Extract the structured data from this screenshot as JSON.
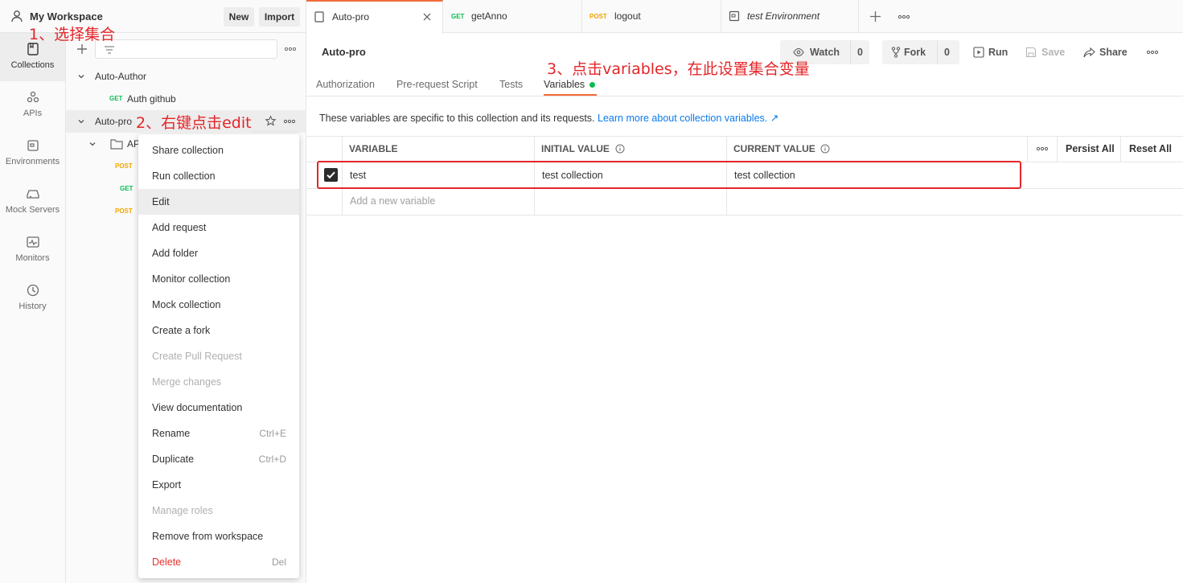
{
  "workspace": {
    "title": "My Workspace",
    "new_label": "New",
    "import_label": "Import"
  },
  "rail": {
    "items": [
      {
        "label": "Collections",
        "icon": "collections-icon"
      },
      {
        "label": "APIs",
        "icon": "apis-icon"
      },
      {
        "label": "Environments",
        "icon": "environments-icon"
      },
      {
        "label": "Mock Servers",
        "icon": "mock-servers-icon"
      },
      {
        "label": "Monitors",
        "icon": "monitors-icon"
      },
      {
        "label": "History",
        "icon": "history-icon"
      }
    ]
  },
  "sidebar": {
    "tree": {
      "auto_author": "Auto-Author",
      "auth_github_method": "GET",
      "auth_github": "Auth github",
      "auto_pro": "Auto-pro",
      "folder": "AP",
      "req1_method": "POST",
      "req2_method": "GET",
      "req3_method": "POST"
    }
  },
  "context_menu": {
    "items": [
      {
        "label": "Share collection",
        "shortcut": ""
      },
      {
        "label": "Run collection",
        "shortcut": ""
      },
      {
        "label": "Edit",
        "shortcut": ""
      },
      {
        "label": "Add request",
        "shortcut": ""
      },
      {
        "label": "Add folder",
        "shortcut": ""
      },
      {
        "label": "Monitor collection",
        "shortcut": ""
      },
      {
        "label": "Mock collection",
        "shortcut": ""
      },
      {
        "label": "Create a fork",
        "shortcut": ""
      },
      {
        "label": "Create Pull Request",
        "shortcut": ""
      },
      {
        "label": "Merge changes",
        "shortcut": ""
      },
      {
        "label": "View documentation",
        "shortcut": ""
      },
      {
        "label": "Rename",
        "shortcut": "Ctrl+E"
      },
      {
        "label": "Duplicate",
        "shortcut": "Ctrl+D"
      },
      {
        "label": "Export",
        "shortcut": ""
      },
      {
        "label": "Manage roles",
        "shortcut": ""
      },
      {
        "label": "Remove from workspace",
        "shortcut": ""
      },
      {
        "label": "Delete",
        "shortcut": "Del"
      }
    ]
  },
  "tabs": [
    {
      "method": "",
      "label": "Auto-pro"
    },
    {
      "method": "GET",
      "label": "getAnno"
    },
    {
      "method": "POST",
      "label": "logout"
    },
    {
      "method": "",
      "label": "test Environment"
    }
  ],
  "collection": {
    "name": "Auto-pro",
    "watch_label": "Watch",
    "watch_count": "0",
    "fork_label": "Fork",
    "fork_count": "0",
    "run_label": "Run",
    "save_label": "Save",
    "share_label": "Share"
  },
  "subtabs": [
    "Authorization",
    "Pre-request Script",
    "Tests",
    "Variables"
  ],
  "variables": {
    "description": "These variables are specific to this collection and its requests.",
    "learn_more": "Learn more about collection variables. ↗",
    "headers": {
      "variable": "VARIABLE",
      "initial": "INITIAL VALUE",
      "current": "CURRENT VALUE"
    },
    "persist_all": "Persist All",
    "reset_all": "Reset All",
    "rows": [
      {
        "enabled": true,
        "variable": "test",
        "initial": "test collection",
        "current": "test collection"
      }
    ],
    "add_placeholder": "Add a new variable"
  },
  "annotations": {
    "step1": "1、选择集合",
    "step2": "2、右键点击edit",
    "step3": "3、点击variables，在此设置集合变量"
  },
  "colors": {
    "accent": "#f26b3a",
    "annotation": "#e3262a",
    "link": "#097bed",
    "status_dot": "#0cbb52"
  }
}
